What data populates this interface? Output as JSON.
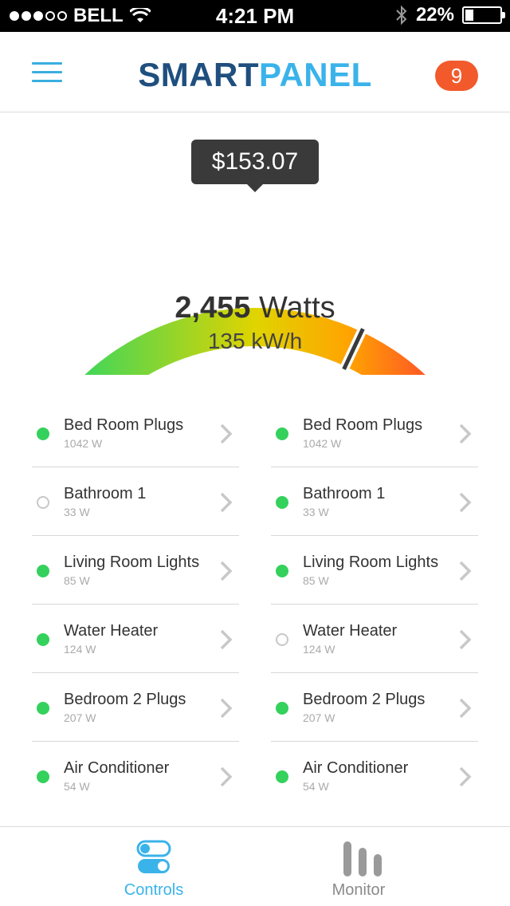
{
  "status_bar": {
    "carrier": "BELL",
    "time": "4:21 PM",
    "battery": "22%",
    "signal_bars_filled": 3,
    "signal_bars_total": 5,
    "battery_level": 0.22
  },
  "header": {
    "brand_part1": "SMART",
    "brand_part2": "PANEL",
    "notification_count": "9",
    "colors": {
      "brand_dark": "#1f4f7e",
      "brand_light": "#3ab3ea",
      "badge": "#f25a2c"
    }
  },
  "gauge": {
    "cost": "$153.07",
    "watts_value": "2,455",
    "watts_unit": "Watts",
    "energy": "135 kW/h",
    "level": 0.5,
    "marker": 0.78,
    "colors": {
      "low": "#36d65f",
      "mid": "#e0d400",
      "high": "#ff4a2c"
    }
  },
  "circuits_left": [
    {
      "name": "Bed Room Plugs",
      "watts": "1042 W",
      "on": true
    },
    {
      "name": "Bathroom 1",
      "watts": "33 W",
      "on": false
    },
    {
      "name": "Living Room Lights",
      "watts": "85 W",
      "on": true
    },
    {
      "name": "Water Heater",
      "watts": "124 W",
      "on": true
    },
    {
      "name": "Bedroom 2 Plugs",
      "watts": "207 W",
      "on": true
    },
    {
      "name": "Air Conditioner",
      "watts": "54 W",
      "on": true
    }
  ],
  "circuits_right": [
    {
      "name": "Bed Room Plugs",
      "watts": "1042 W",
      "on": true
    },
    {
      "name": "Bathroom 1",
      "watts": "33 W",
      "on": true
    },
    {
      "name": "Living Room Lights",
      "watts": "85 W",
      "on": true
    },
    {
      "name": "Water Heater",
      "watts": "124 W",
      "on": false
    },
    {
      "name": "Bedroom 2 Plugs",
      "watts": "207 W",
      "on": true
    },
    {
      "name": "Air Conditioner",
      "watts": "54 W",
      "on": true
    }
  ],
  "tabs": {
    "controls_label": "Controls",
    "monitor_label": "Monitor",
    "active": "Controls"
  },
  "icons": {
    "menu": "hamburger-icon",
    "wifi": "wifi-icon",
    "bluetooth": "bluetooth-icon",
    "battery": "battery-icon",
    "chevron": "chevron-right-icon",
    "controls": "toggles-icon",
    "monitor": "bar-chart-icon"
  }
}
